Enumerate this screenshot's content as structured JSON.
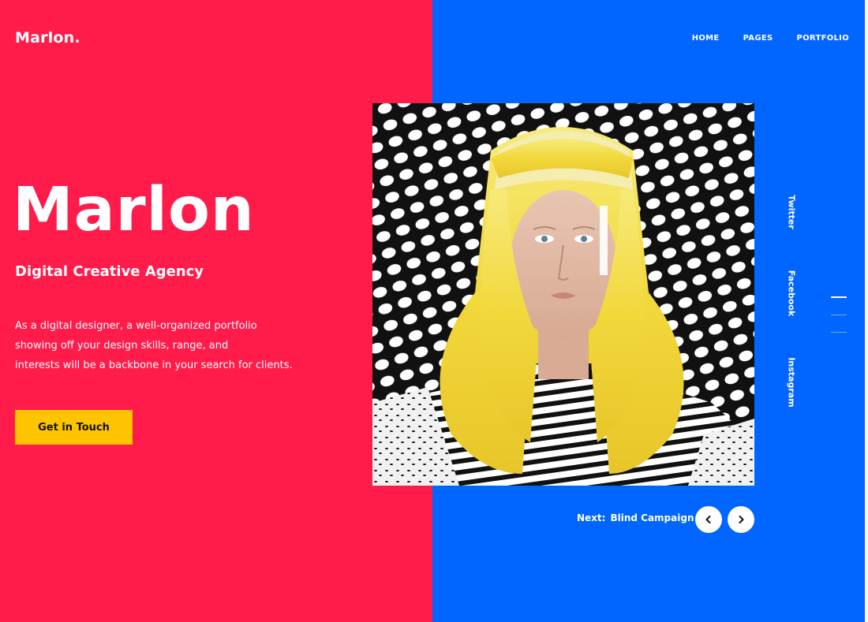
{
  "brand": {
    "logo": "Marlon."
  },
  "nav": {
    "items": [
      "HOME",
      "PAGES",
      "PORTFOLIO"
    ]
  },
  "hero": {
    "title": "Marlon",
    "subtitle": "Digital Creative Agency",
    "description_lines": [
      "As a digital designer, a well-organized portfolio",
      "showing off your design skills, range, and",
      "interests will be a backbone in your search for clients."
    ],
    "cta_label": "Get in Touch"
  },
  "social": {
    "links": [
      "Twitter",
      "Facebook",
      "Instagram"
    ]
  },
  "slider": {
    "next_prefix": "Next:",
    "next_title": "Blind Campaign",
    "active_index": 1,
    "total": 3,
    "prev_icon": "chevron-left-icon",
    "next_icon": "chevron-right-icon"
  },
  "colors": {
    "left_panel": "#ff1b4a",
    "right_panel": "#0066ff",
    "cta_background": "#ffc400",
    "text": "#ffffff",
    "hair": "#f2d83b"
  }
}
